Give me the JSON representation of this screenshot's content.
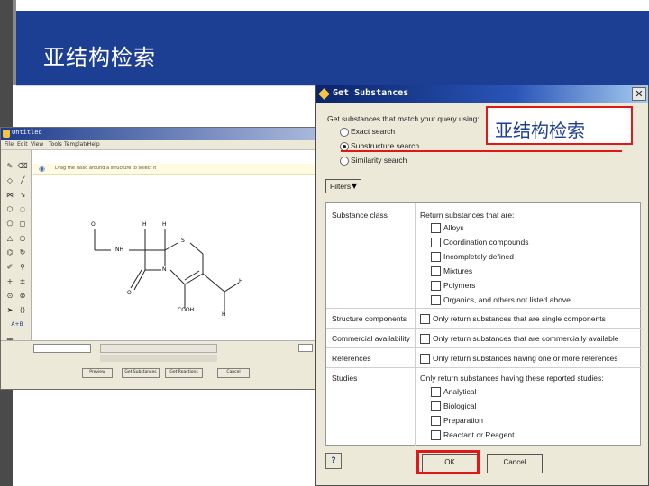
{
  "slide": {
    "title": "亚结构检索"
  },
  "chem_window": {
    "title": "Untitled",
    "menu": [
      "File",
      "Edit",
      "View",
      "Tools",
      "Template",
      "Help"
    ],
    "hint": "Drag the lasso around a structure to select it",
    "molecule_labels": {
      "o1": "O",
      "nh": "NH",
      "h1": "H",
      "h2": "H",
      "s": "S",
      "n": "N",
      "o2": "O",
      "h3": "H",
      "h4": "H",
      "cooh": "COOH"
    },
    "toolbar_label": "A+B",
    "buttons": [
      "Preview",
      "Get Substances",
      "Get Reactions",
      "Cancel"
    ]
  },
  "dialog": {
    "title": "Get Substances",
    "prompt": "Get substances that match your query using:",
    "radio_options": [
      "Exact search",
      "Substructure search",
      "Similarity search"
    ],
    "selected_index": 1,
    "filters_label": "Filters",
    "sections": {
      "substance_class": {
        "label": "Substance class",
        "heading": "Return substances that are:",
        "options": [
          "Alloys",
          "Coordination compounds",
          "Incompletely defined",
          "Mixtures",
          "Polymers",
          "Organics, and others not listed above"
        ]
      },
      "structure_components": {
        "label": "Structure components",
        "option": "Only return substances that are single components"
      },
      "commercial_availability": {
        "label": "Commercial availability",
        "option": "Only return substances that are commercially available"
      },
      "references": {
        "label": "References",
        "option": "Only return substances having one or more references"
      },
      "studies": {
        "label": "Studies",
        "heading": "Only return substances having these reported studies:",
        "options": [
          "Analytical",
          "Biological",
          "Preparation",
          "Reactant or Reagent"
        ]
      }
    },
    "ok_label": "OK",
    "cancel_label": "Cancel",
    "help_icon_glyph": "?"
  },
  "annotation": {
    "label": "亚结构检索",
    "color": "#e01818"
  }
}
